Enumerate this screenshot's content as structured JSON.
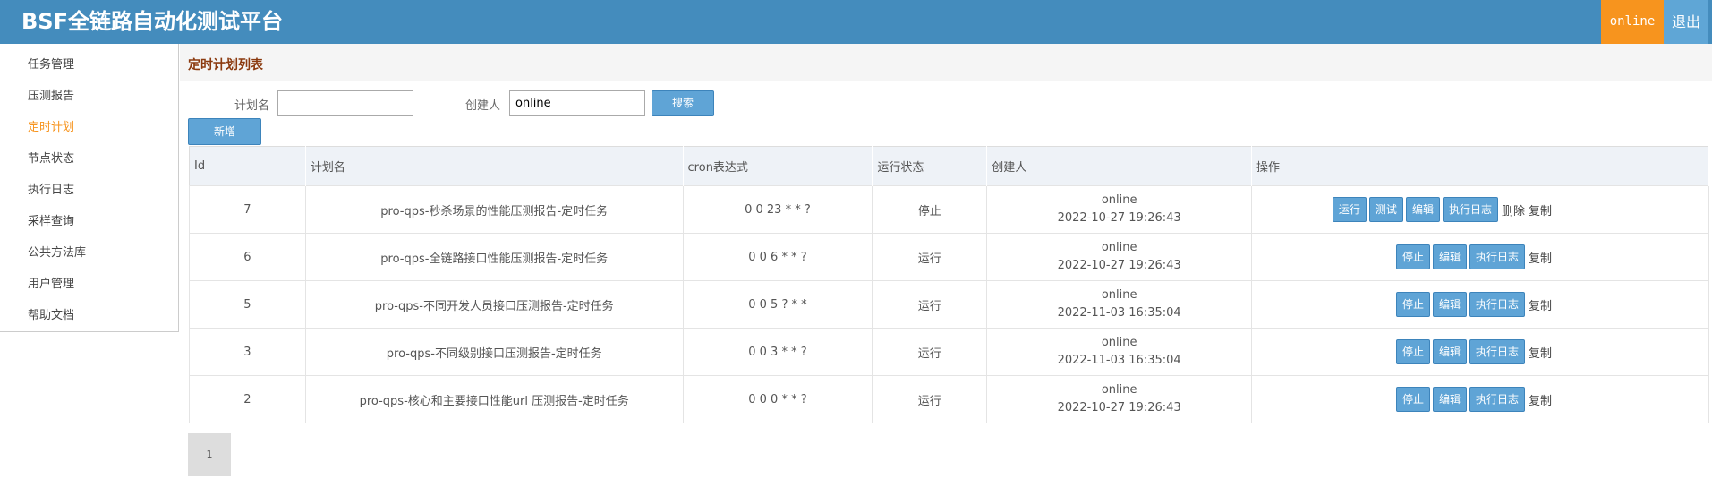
{
  "header": {
    "title": "BSF全链路自动化测试平台",
    "user": "online",
    "logout_label": "退出"
  },
  "sidebar": {
    "items": [
      {
        "label": "任务管理"
      },
      {
        "label": "压测报告"
      },
      {
        "label": "定时计划"
      },
      {
        "label": "节点状态"
      },
      {
        "label": "执行日志"
      },
      {
        "label": "采样查询"
      },
      {
        "label": "公共方法库"
      },
      {
        "label": "用户管理"
      },
      {
        "label": "帮助文档"
      }
    ],
    "active_index": 2
  },
  "main": {
    "title": "定时计划列表"
  },
  "search": {
    "name_label": "计划名",
    "name_value": "",
    "name_placeholder": "",
    "creator_label": "创建人",
    "creator_value": "online",
    "search_label": "搜索",
    "add_label": "新增"
  },
  "table": {
    "headers": [
      "Id",
      "计划名",
      "cron表达式",
      "运行状态",
      "创建人",
      "操作"
    ],
    "rows": [
      {
        "id": "7",
        "name": "pro-qps-秒杀场景的性能压测报告-定时任务",
        "cron": "0 0 23 * * ?",
        "status": "停止",
        "status_type": "stop",
        "creator": "online",
        "created": "2022-10-27 19:26:43",
        "actions": [
          "运行",
          "测试",
          "编辑",
          "执行日志"
        ],
        "links": [
          "删除",
          "复制"
        ]
      },
      {
        "id": "6",
        "name": "pro-qps-全链路接口性能压测报告-定时任务",
        "cron": "0 0 6 * * ?",
        "status": "运行",
        "status_type": "run",
        "creator": "online",
        "created": "2022-10-27 19:26:43",
        "actions": [
          "停止",
          "编辑",
          "执行日志"
        ],
        "links": [
          "复制"
        ]
      },
      {
        "id": "5",
        "name": "pro-qps-不同开发人员接口压测报告-定时任务",
        "cron": "0 0 5 ? * *",
        "status": "运行",
        "status_type": "run",
        "creator": "online",
        "created": "2022-11-03 16:35:04",
        "actions": [
          "停止",
          "编辑",
          "执行日志"
        ],
        "links": [
          "复制"
        ]
      },
      {
        "id": "3",
        "name": "pro-qps-不同级别接口压测报告-定时任务",
        "cron": "0 0 3 * * ?",
        "status": "运行",
        "status_type": "run",
        "creator": "online",
        "created": "2022-11-03 16:35:04",
        "actions": [
          "停止",
          "编辑",
          "执行日志"
        ],
        "links": [
          "复制"
        ]
      },
      {
        "id": "2",
        "name": "pro-qps-核心和主要接口性能url 压测报告-定时任务",
        "cron": "0 0 0 * * ?",
        "status": "运行",
        "status_type": "run",
        "creator": "online",
        "created": "2022-10-27 19:26:43",
        "actions": [
          "停止",
          "编辑",
          "执行日志"
        ],
        "links": [
          "复制"
        ]
      }
    ]
  },
  "pagination": {
    "current": "1"
  },
  "colors": {
    "header_bg": "#448cbd",
    "user_bg": "#f7941e",
    "button": "#5fa4d6",
    "active": "#f7941e",
    "stop": "#e00000",
    "run": "#1a9a1a"
  }
}
